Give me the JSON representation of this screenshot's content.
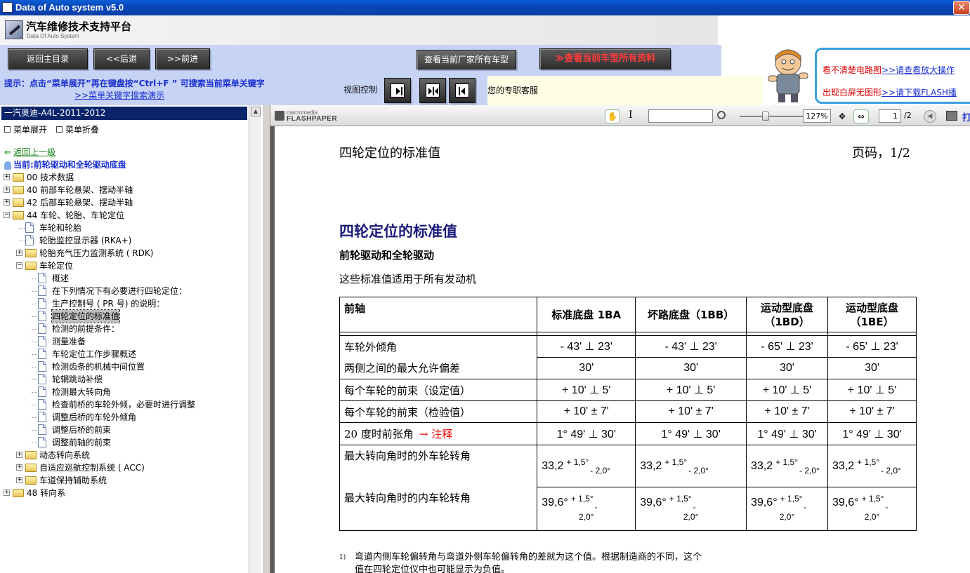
{
  "window": {
    "title": "Data of Auto system v5.0",
    "close_glyph": "✕"
  },
  "brand": {
    "name": "汽车维修技术支持平台",
    "subtitle": "Data Of Auto System"
  },
  "nav": {
    "home": "返回主目录",
    "back": "<<后退",
    "forward": ">>前进",
    "view_models": "查看当前厂家所有车型",
    "view_all": "≫查看当前车型所有资料"
  },
  "promo": {
    "line1_text": "看不清楚电路图",
    "line1_link": ">>请查看放大操作",
    "line2_text": "出现白屏无图形",
    "line2_link": ">>请下载FLASH播"
  },
  "tip": {
    "text": "提示：点击“菜单展开”再在键盘按“Ctrl+F ” 可搜索当前菜单关键字",
    "demo_link": ">>菜单关键字搜索演示",
    "view_control": "视图控制",
    "service": "您的专职客服"
  },
  "sidebar": {
    "header": "一汽奥迪-A4L-2011-2012",
    "expand": "菜单展开",
    "collapse": "菜单折叠",
    "back_up": "返回上一级",
    "current": "当前:前轮驱动和全轮驱动底盘",
    "tree": [
      {
        "label": "00 技术数据",
        "type": "folder",
        "level": 0,
        "toggle": "+"
      },
      {
        "label": "40 前部车轮悬架、摆动半轴",
        "type": "folder",
        "level": 0,
        "toggle": "+"
      },
      {
        "label": "42 后部车轮悬架、摆动半轴",
        "type": "folder",
        "level": 0,
        "toggle": "+"
      },
      {
        "label": "44 车轮、轮胎、车轮定位",
        "type": "folder",
        "level": 0,
        "toggle": "-"
      },
      {
        "label": "车轮和轮胎",
        "type": "doc",
        "level": 1
      },
      {
        "label": "轮胎监控显示器 (RKA+)",
        "type": "doc",
        "level": 1
      },
      {
        "label": "轮胎充气压力监测系统 ( RDK)",
        "type": "folder",
        "level": 1,
        "toggle": "+"
      },
      {
        "label": "车轮定位",
        "type": "folder",
        "level": 1,
        "toggle": "-"
      },
      {
        "label": "概述",
        "type": "doc",
        "level": 2
      },
      {
        "label": "在下列情况下有必要进行四轮定位：",
        "type": "doc",
        "level": 2
      },
      {
        "label": "生产控制号 ( PR 号) 的说明：",
        "type": "doc",
        "level": 2
      },
      {
        "label": "四轮定位的标准值",
        "type": "doc",
        "level": 2,
        "selected": true
      },
      {
        "label": "检测的前提条件：",
        "type": "doc",
        "level": 2
      },
      {
        "label": "测量准备",
        "type": "doc",
        "level": 2
      },
      {
        "label": "车轮定位工作步骤概述",
        "type": "doc",
        "level": 2
      },
      {
        "label": "检测齿条的机械中间位置",
        "type": "doc",
        "level": 2
      },
      {
        "label": "轮辋跳动补偿",
        "type": "doc",
        "level": 2
      },
      {
        "label": "检测最大转向角",
        "type": "doc",
        "level": 2
      },
      {
        "label": "检查前桥的车轮外倾，必要时进行调整",
        "type": "doc",
        "level": 2
      },
      {
        "label": "调整后桥的车轮外倾角",
        "type": "doc",
        "level": 2
      },
      {
        "label": "调整后桥的前束",
        "type": "doc",
        "level": 2
      },
      {
        "label": "调整前轴的前束",
        "type": "doc",
        "level": 2
      },
      {
        "label": "动态转向系统",
        "type": "folder",
        "level": 1,
        "toggle": "+"
      },
      {
        "label": "自适应巡航控制系统 ( ACC)",
        "type": "folder",
        "level": 1,
        "toggle": "+"
      },
      {
        "label": "车道保持辅助系统",
        "type": "folder",
        "level": 1,
        "toggle": "+"
      },
      {
        "label": "48 转向系",
        "type": "folder",
        "level": 0,
        "toggle": "+"
      }
    ]
  },
  "viewer": {
    "brand_top": "macromedia",
    "brand_name": "FLASHPAPER",
    "zoom": "127%",
    "page_current": "1",
    "page_total": "/2",
    "print_label": "打",
    "search_value": ""
  },
  "doc": {
    "header_left": "四轮定位的标准值",
    "header_right": "页码，1/2",
    "title": "四轮定位的标准值",
    "subtitle": "前轮驱动和全轮驱动",
    "intro": "这些标准值适用于所有发动机",
    "table": {
      "headers": [
        "前轴",
        "标准底盘 1BA",
        "坏路底盘（1BB）",
        "运动型底盘（1BD）",
        "运动型底盘（1BE）"
      ],
      "rows": [
        {
          "label": "车轮外倾角",
          "values": [
            "- 43' ⊥ 23'",
            "- 43' ⊥ 23'",
            "- 65' ⊥ 23'",
            "- 65' ⊥ 23'"
          ]
        },
        {
          "label": "两侧之间的最大允许偏差",
          "values": [
            "30'",
            "30'",
            "30'",
            "30'"
          ]
        },
        {
          "label": "每个车轮的前束（设定值）",
          "values": [
            "+ 10' ⊥ 5'",
            "+ 10' ⊥ 5'",
            "+ 10' ⊥ 5'",
            "+ 10' ⊥ 5'"
          ]
        },
        {
          "label": "每个车轮的前束（检验值）",
          "values": [
            "+ 10' ± 7'",
            "+ 10' ± 7'",
            "+ 10' ± 7'",
            "+ 10' ± 7'"
          ]
        },
        {
          "label": "20 度时前张角",
          "note": "→ 注释",
          "values": [
            "1°  49' ⊥ 30'",
            "1°  49' ⊥ 30'",
            "1°  49' ⊥ 30'",
            "1°  49' ⊥ 30'"
          ]
        }
      ],
      "outer_label": "最大转向角时的外车轮转角",
      "outer": {
        "base": "33,2",
        "plus": "+ 1,5°",
        "minus": "- 2,0°"
      },
      "inner_label": "最大转向角时的内车轮转角",
      "inner": {
        "base": "39,6°",
        "plus": "+ 1,5°",
        "minus": "-",
        "minus2": "2,0°"
      }
    },
    "footnote_num": "1)",
    "footnote": "弯道内侧车轮偏转角与弯道外侧车轮偏转角的差就为这个值。根据制造商的不同，这个值在四轮定位仪中也可能显示为负值。"
  }
}
